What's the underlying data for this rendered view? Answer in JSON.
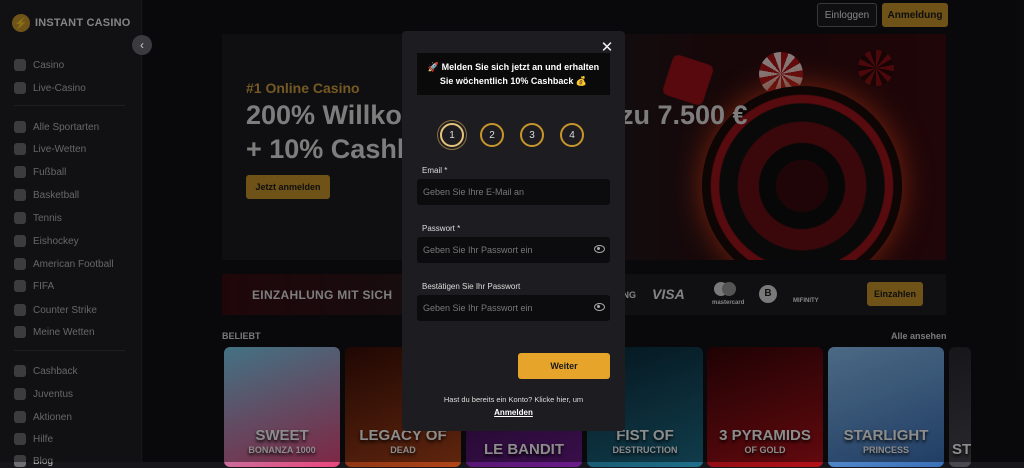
{
  "brand": {
    "logo_text": "INSTANT CASINO"
  },
  "sidebar": {
    "collapse_glyph": "‹",
    "items": [
      {
        "label": "Casino",
        "icon": "casino-icon"
      },
      {
        "label": "Live-Casino",
        "icon": "live-casino-icon"
      },
      {
        "label": "Alle Sportarten",
        "icon": "sports-icon"
      },
      {
        "label": "Live-Wetten",
        "icon": "live-bet-icon"
      },
      {
        "label": "Fußball",
        "icon": "football-icon"
      },
      {
        "label": "Basketball",
        "icon": "basketball-icon"
      },
      {
        "label": "Tennis",
        "icon": "tennis-icon"
      },
      {
        "label": "Eishockey",
        "icon": "hockey-icon"
      },
      {
        "label": "American Football",
        "icon": "american-football-icon"
      },
      {
        "label": "FIFA",
        "icon": "fifa-icon"
      },
      {
        "label": "Counter Strike",
        "icon": "counter-strike-icon"
      },
      {
        "label": "Meine Wetten",
        "icon": "my-bets-icon"
      },
      {
        "label": "Cashback",
        "icon": "cashback-icon"
      },
      {
        "label": "Juventus",
        "icon": "juventus-icon"
      },
      {
        "label": "Aktionen",
        "icon": "promotions-icon"
      },
      {
        "label": "Hilfe",
        "icon": "help-icon"
      },
      {
        "label": "Blog",
        "icon": "blog-icon"
      }
    ]
  },
  "header": {
    "login_label": "Einloggen",
    "register_label": "Anmeldung"
  },
  "hero": {
    "subtitle": "#1 Online Casino",
    "title_line1": "200% Willko",
    "title_line1_right": "zu 7.500 €",
    "title_line2": "+ 10% Cashb",
    "cta_label": "Jetzt anmelden"
  },
  "payments": {
    "text": "EINZAHLUNG MIT SICH",
    "logos": [
      "ING",
      "VISA",
      "mastercard",
      "B",
      "MIFINITY"
    ],
    "button_label": "Einzahlen"
  },
  "games_section": {
    "title": "BELIEBT",
    "see_all": "Alle ansehen",
    "games": [
      {
        "title": "SWEET",
        "subtitle": "BONANZA 1000",
        "color": "#e9457a"
      },
      {
        "title": "LEGACY OF",
        "subtitle": "DEAD",
        "color": "#b0451a"
      },
      {
        "title": "LE BANDIT",
        "subtitle": "",
        "color": "#6a1c8a"
      },
      {
        "title": "FIST OF",
        "subtitle": "DESTRUCTION",
        "color": "#1f6f8a"
      },
      {
        "title": "3 PYRAMIDS",
        "subtitle": "OF GOLD",
        "color": "#b4121a"
      },
      {
        "title": "STARLIGHT",
        "subtitle": "PRINCESS",
        "color": "#3a6fb8"
      },
      {
        "title": "ST",
        "subtitle": "",
        "color": "#4a4a52"
      }
    ]
  },
  "modal": {
    "close_glyph": "✕",
    "promo_line1": "🚀 Melden Sie sich jetzt an und erhalten",
    "promo_line2": "Sie wöchentlich 10% Cashback 💰",
    "steps": [
      "1",
      "2",
      "3",
      "4"
    ],
    "email_label": "Email *",
    "email_placeholder": "Geben Sie Ihre E-Mail an",
    "password_label": "Passwort *",
    "password_placeholder": "Geben Sie Ihr Passwort ein",
    "confirm_label": "Bestätigen Sie Ihr Passwort",
    "confirm_placeholder": "Geben Sie Ihr Passwort ein",
    "submit_label": "Weiter",
    "hint": "Hast du bereits ein Konto? Klicke hier, um",
    "hint_link": "Anmelden"
  }
}
